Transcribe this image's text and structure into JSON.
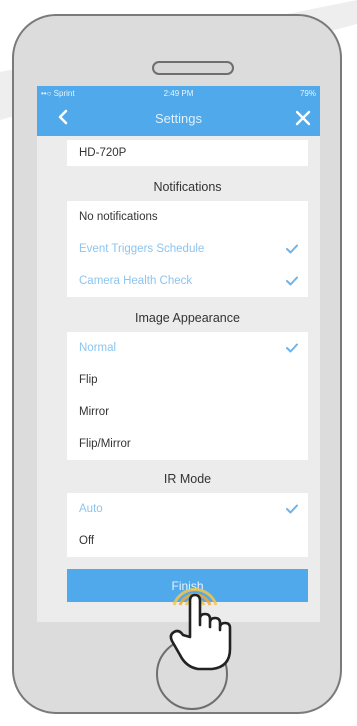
{
  "status_bar": {
    "carrier": "••○ Sprint",
    "time": "2:49 PM",
    "battery": "79%"
  },
  "header": {
    "title": "Settings"
  },
  "resolution": {
    "value": "HD-720P"
  },
  "notifications": {
    "title": "Notifications",
    "items": [
      {
        "label": "No notifications",
        "selected": false
      },
      {
        "label": "Event Triggers Schedule",
        "selected": true
      },
      {
        "label": "Camera Health Check",
        "selected": true
      }
    ]
  },
  "image_appearance": {
    "title": "Image Appearance",
    "items": [
      {
        "label": "Normal",
        "selected": true
      },
      {
        "label": "Flip",
        "selected": false
      },
      {
        "label": "Mirror",
        "selected": false
      },
      {
        "label": "Flip/Mirror",
        "selected": false
      }
    ]
  },
  "ir_mode": {
    "title": "IR Mode",
    "items": [
      {
        "label": "Auto",
        "selected": true
      },
      {
        "label": "Off",
        "selected": false
      }
    ]
  },
  "finish": {
    "label": "Finish"
  },
  "colors": {
    "accent": "#4fa9ea",
    "selected_text": "#8dc4ee",
    "background": "#ececec"
  },
  "icons": [
    "back-chevron",
    "close-x",
    "checkmark",
    "tap-hand"
  ]
}
